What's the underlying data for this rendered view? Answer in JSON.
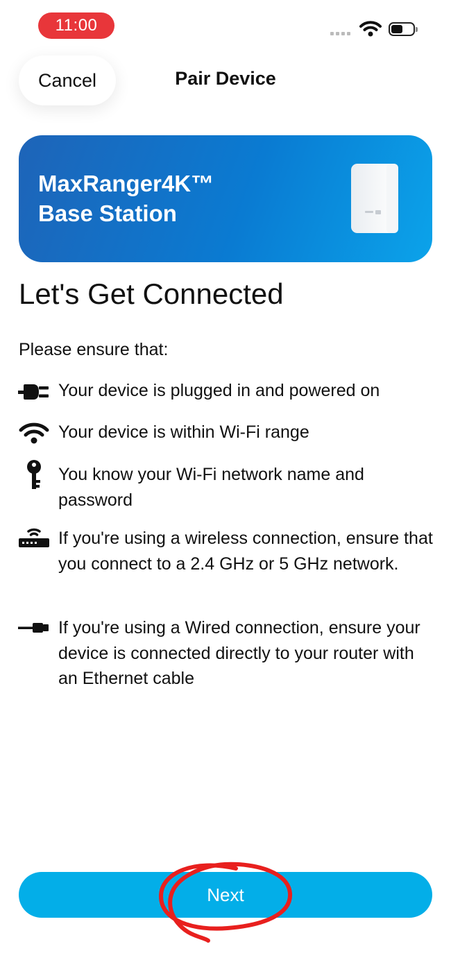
{
  "status_bar": {
    "time": "11:00",
    "icons": [
      "cellular-dots-icon",
      "wifi-icon",
      "battery-icon"
    ],
    "time_pill_color": "#e8363a"
  },
  "nav": {
    "cancel_label": "Cancel",
    "title": "Pair Device"
  },
  "banner": {
    "line1": "MaxRanger4K™",
    "line2": "Base Station",
    "gradient": [
      "#1e64b8",
      "#0ba3ea"
    ]
  },
  "main": {
    "heading": "Let's Get Connected",
    "intro": "Please ensure that:",
    "requirements": [
      {
        "icon": "power-plug-icon",
        "text": "Your device is plugged in and powered on"
      },
      {
        "icon": "wifi-icon",
        "text": "Your device is within Wi-Fi range"
      },
      {
        "icon": "key-icon",
        "text": "You know your Wi-Fi network name and password"
      },
      {
        "icon": "router-icon",
        "text": "If you're using a wireless connection, ensure that you connect to a 2.4 GHz or 5 GHz network."
      },
      {
        "icon": "ethernet-cable-icon",
        "text": "If you're using a Wired connection, ensure your device is connected directly to your router with an Ethernet cable"
      }
    ]
  },
  "footer": {
    "next_label": "Next",
    "button_color": "#03aee8",
    "annotation_color": "#e8201e"
  }
}
